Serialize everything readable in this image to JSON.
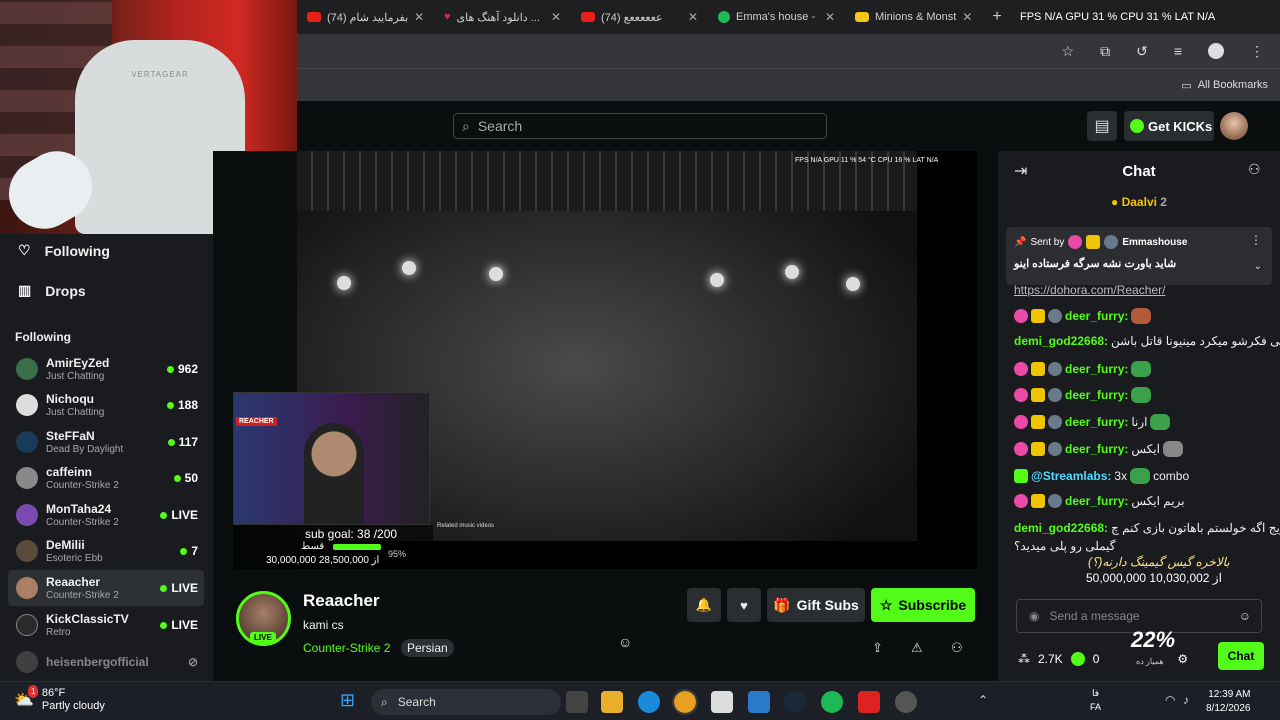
{
  "browser": {
    "tabs": [
      {
        "title": "(74) بفرمایید شام",
        "favicon": "youtube-icon"
      },
      {
        "title": "دانلود آهنگ های ...",
        "favicon": "heart-icon"
      },
      {
        "title": "(74) ععععععع",
        "favicon": "youtube-icon"
      },
      {
        "title": "Emma's house -",
        "favicon": "spotify-icon"
      },
      {
        "title": "Minions & Monst",
        "favicon": "minions-icon"
      }
    ],
    "overlay_stats": "FPS N/A  GPU 31 %  CPU 31 %  LAT N/A",
    "bookmarks_label": "All Bookmarks"
  },
  "webcam": {
    "chair_brand": "VERTAGEAR"
  },
  "kick_header": {
    "search_placeholder": "Search",
    "get_kicks_label": "Get KICKs"
  },
  "sidebar": {
    "following_link": "Following",
    "drops_link": "Drops",
    "section_title": "Following",
    "channels": [
      {
        "name": "AmirEyZed",
        "category": "Just Chatting",
        "viewers": "962"
      },
      {
        "name": "Nichoqu",
        "category": "Just Chatting",
        "viewers": "188"
      },
      {
        "name": "SteFFaN",
        "category": "Dead By Daylight",
        "viewers": "117"
      },
      {
        "name": "caffeinn",
        "category": "Counter-Strike 2",
        "viewers": "50"
      },
      {
        "name": "MonTaha24",
        "category": "Counter-Strike 2",
        "viewers": "LIVE"
      },
      {
        "name": "DeMilii",
        "category": "Esoteric Ebb",
        "viewers": "7"
      },
      {
        "name": "Reaacher",
        "category": "Counter-Strike 2",
        "viewers": "LIVE"
      },
      {
        "name": "KickClassicTV",
        "category": "Retro",
        "viewers": "LIVE"
      },
      {
        "name": "heisenbergofficial",
        "category": "",
        "viewers": ""
      }
    ]
  },
  "video": {
    "stats_line": "FPS N/A  GPU 11 %  54 °C  CPU 16 %  LAT N/A",
    "cam_tag": "REACHER",
    "sub_goal": "sub goal: 38 /200",
    "goal_label": "قسط",
    "goal_money": "30,000,000 از 28,500,000",
    "goal_percent": "95%",
    "goal_fraction": 0.95,
    "related_label": "Related music videos"
  },
  "stream": {
    "name": "Reaacher",
    "title": "kami cs",
    "category": "Counter-Strike 2",
    "language": "Persian",
    "live_badge": "LIVE",
    "gift_label": "Gift Subs",
    "subscribe_label": "Subscribe"
  },
  "chat": {
    "title": "Chat",
    "top_gifter": "Daalvi",
    "top_gifter_count": "2",
    "pinned_sender": "Emmashouse",
    "pinned_sent_by": "Sent by",
    "pinned_message": "شاید باورت نشه سرگه فرستاده اینو",
    "messages": [
      {
        "user": "",
        "text": "https://dohora.com/Reacher/"
      },
      {
        "user": "deer_furry:",
        "text": ""
      },
      {
        "user": "demi_god22668:",
        "text": "کی فکرشو میکرد مینیونا قاتل باشن"
      },
      {
        "user": "deer_furry:",
        "text": ""
      },
      {
        "user": "deer_furry:",
        "text": ""
      },
      {
        "user": "deer_furry:",
        "text": "ارنا"
      },
      {
        "user": "deer_furry:",
        "text": "ایکس"
      },
      {
        "user": "@Streamlabs:",
        "text": "3x",
        "extra": "combo"
      },
      {
        "user": "deer_furry:",
        "text": "بریم ایکس"
      },
      {
        "user": "demi_god22668:",
        "text": "ریج اگه خولستم باهاتون بازی کنم چ"
      },
      {
        "user": "",
        "text": "گیملی رو پلی میدید؟"
      }
    ],
    "overlay_text": "بالاخره گیس گیمینگ دارنه(؟)",
    "overlay_money": "50,000,000 از 10,030,002",
    "input_placeholder": "Send a message",
    "stat_users": "2.7K",
    "stat_kicks": "0",
    "cpu_overlay": "22%",
    "cpu_overlay_sub": "همیار ده",
    "send_label": "Chat"
  },
  "taskbar": {
    "temperature": "86°F",
    "weather": "Partly cloudy",
    "search_label": "Search",
    "lang_top": "فا",
    "lang_bottom": "FA",
    "time": "12:39 AM",
    "date": "8/12/2026",
    "notification_count": "1"
  },
  "colors": {
    "accent": "#53fc18",
    "bg": "#0b0e0f",
    "panel": "#191b1f"
  }
}
